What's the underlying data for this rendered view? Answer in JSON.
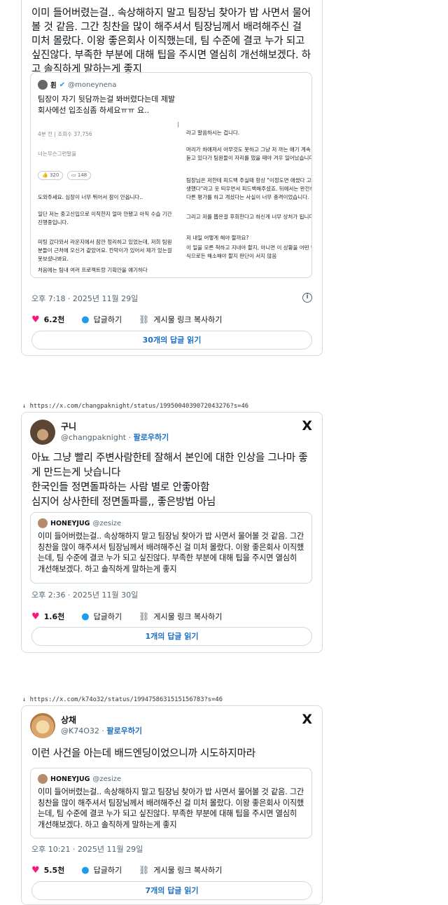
{
  "tweet1": {
    "body": "이미 들어버렸는걸.. 속상해하지 말고 팀장님 찾아가 밥 사면서 물어볼 것 같음. 그간 칭찬을 많이 해주셔서 팀장님께서 배려해주신 걸 미처 몰랐다. 이왕 좋은회사 이직했는데, 팀 수준에 결코 누가 되고 싶진않다. 부족한 부분에 대해 팁을 주시면 열심히 개선해보겠다. 하고 솔직하게 말하는게 좋지",
    "quote": {
      "name": "휜",
      "handle": "@moneynena",
      "title": "팀장이 자기 뒷담까는걸 봐버렸다는데 제발 회사에선 입조심좀 하세요ㅠㅠ 요..",
      "meta_small": "4분 전 | 조회수 37,756",
      "left_lines": [
        "도와주세요. 심장이 너무 뛰어서 잠이 안옵니다..",
        "일단 저는 중고신입으로 이직한지 얼마 안됐고 아직 수습 기간 진행중입니다.",
        "미팅 갔다와서 라운지에서 잠깐 정리하고 있었는데, 저희 팀원분들이 근처에 오신거 같았어요. 칸막이가 있어서 제가 있는걸 못보셨나봐요.",
        "처음에는 팀내 여러 프로젝트랑 기획안을 얘기하다"
      ],
      "right_lines": [
        "라고 말씀하시는 겁니다.",
        "머리가 하얘져서 아무것도 못하고 그냥 저 까는 얘기 계속 듣고 있다가 팀원들이 자리를 떴을 때야 겨우 일어났습니다.",
        "팀장님은 저한테 피드백 주실때 항상 \"이정도면 애썼다 고생했다\"라고 웃 띄우면서 피드백해주셨죠. 뒤에서는 완전히 다른 평가를 하고 계셨다는 사실이 너무 충격이었습니다.",
        "그리고 저를 뽑은걸 후회한다고 하신게 너무 상처가 됩니다.",
        "저 내일 어떻게 해야 할까요?",
        "이 일을 모른 척하고 지내야 할지, 아니면 이 상황을 어떤 방식으로든 해소해야 할지 판단이 서지 않음"
      ],
      "company_tag": "너는무슨그런말을",
      "likes_pill": "320",
      "comments_pill": "148"
    },
    "time": "오후 7:18 · 2025년 11월 29일",
    "likes": "6.2천",
    "reply_label": "답글하기",
    "copy_label": "게시물 링크 복사하기",
    "read_replies": "30개의 답글 읽기"
  },
  "tweet2": {
    "url": "https://x.com/changpaknight/status/1995004039072043276?s=46",
    "name": "구니",
    "handle": "@changpaknight",
    "follow": "팔로우하기",
    "body": "아뇨 그냥 빨리 주변사람한테 잘해서 본인에 대한 인상을 그나마 좋게 만드는게 낫습니다\n한국인들 정면돌파하는 사람 별로 안좋아함\n심지어 상사한테 정면돌파를,, 좋은방법 아님",
    "quote_name": "HONEYJUG",
    "quote_handle": "@zesize",
    "quote_text": "이미 들어버렸는걸.. 속상해하지 말고 팀장님 찾아가 밥 사면서 물어볼 것 같음. 그간 칭찬을 많이 해주셔서 팀장님께서 배려해주신 걸 미처 몰랐다. 이왕 좋은회사 이직했는데, 팀 수준에 결코 누가 되고 싶진않다. 부족한 부분에 대해 팁을 주시면 열심히 개선해보겠다. 하고 솔직하게 말하는게 좋지",
    "time": "오후 2:36 · 2025년 11월 30일",
    "likes": "1.6천",
    "reply_label": "답글하기",
    "copy_label": "게시물 링크 복사하기",
    "read_replies": "1개의 답글 읽기"
  },
  "tweet3": {
    "url": "https://x.com/k74o32/status/1994758631515156783?s=46",
    "name": "상채",
    "handle": "@K74O32",
    "follow": "팔로우하기",
    "body": "이런 사건을 아는데 배드엔딩이었으니까 시도하지마라",
    "quote_name": "HONEYJUG",
    "quote_handle": "@zesize",
    "quote_text": "이미 들어버렸는걸.. 속상해하지 말고 팀장님 찾아가 밥 사면서 물어볼 것 같음. 그간 칭찬을 많이 해주셔서 팀장님께서 배려해주신 걸 미처 몰랐다. 이왕 좋은회사 이직했는데, 팀 수준에 결코 누가 되고 싶진않다. 부족한 부분에 대해 팁을 주시면 열심히 개선해보겠다. 하고 솔직하게 말하는게 좋지",
    "time": "오후 10:21 · 2025년 11월 29일",
    "likes": "5.5천",
    "reply_label": "답글하기",
    "copy_label": "게시물 링크 복사하기",
    "read_replies": "7개의 답글 읽기"
  },
  "icons": {
    "x_logo": "X",
    "heart": "♥",
    "bubble": "💬",
    "link": "🔗",
    "info": "i",
    "download": "↓"
  },
  "colors": {
    "accent": "#1d9bf0",
    "like": "#f91880",
    "border": "#cfd9de",
    "text": "#0f1419",
    "muted": "#536471"
  }
}
